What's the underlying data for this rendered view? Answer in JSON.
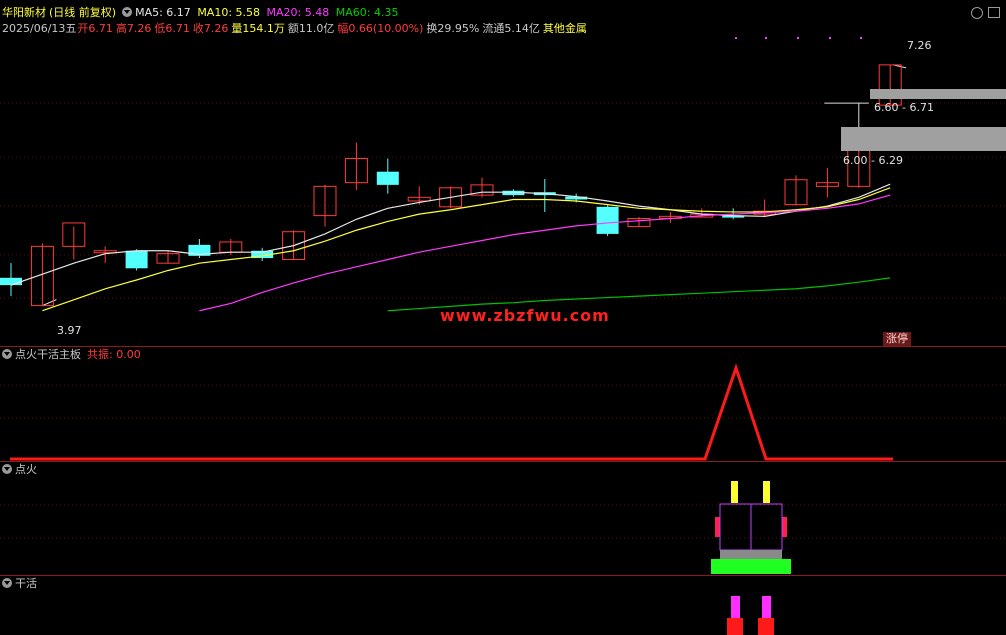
{
  "stock": {
    "name": "华阳新材",
    "period": "(日线 前复权)",
    "date": "2025/06/13五",
    "open": "开6.71",
    "high": "高7.26",
    "low": "低6.71",
    "close": "收7.26",
    "volume": "量154.1万",
    "amount": "额11.0亿",
    "change": "幅0.66(10.00%)",
    "turnover": "换29.95%",
    "float_cap": "流通5.14亿",
    "sector": "其他金属"
  },
  "ma": {
    "ma5": "MA5: 6.17",
    "ma10": "MA10: 5.58",
    "ma20": "MA20: 5.48",
    "ma60": "MA60: 4.35"
  },
  "price_labels": {
    "high_mark": "7.26",
    "low_mark": "3.97",
    "range1": "6.60 - 6.71",
    "range2": "6.00 - 6.29",
    "limit_up": "涨停"
  },
  "watermark": "www.zbzfwu.com",
  "indicators": {
    "ind1_title": "点火干活主板",
    "ind1_value": "共振: 0.00",
    "ind2_title": "点火",
    "ind3_title": "干活"
  },
  "colors": {
    "up": "#ff3b3b",
    "down": "#54ffff",
    "ma5": "#e6e6e6",
    "ma10": "#ffff3a",
    "ma20": "#ff3aff",
    "ma60": "#00c000",
    "separator": "#8b1a1a"
  },
  "chart_data": {
    "type": "candlestick",
    "y_range": [
      3.5,
      7.6
    ],
    "candles": [
      {
        "o": 4.35,
        "h": 4.55,
        "l": 4.1,
        "c": 4.25
      },
      {
        "o": 3.97,
        "h": 4.82,
        "l": 3.97,
        "c": 4.78
      },
      {
        "o": 4.78,
        "h": 5.05,
        "l": 4.6,
        "c": 5.1
      },
      {
        "o": 4.72,
        "h": 4.78,
        "l": 4.55,
        "c": 4.72
      },
      {
        "o": 4.72,
        "h": 4.74,
        "l": 4.45,
        "c": 4.48
      },
      {
        "o": 4.55,
        "h": 4.72,
        "l": 4.55,
        "c": 4.68
      },
      {
        "o": 4.8,
        "h": 4.88,
        "l": 4.62,
        "c": 4.65
      },
      {
        "o": 4.7,
        "h": 4.88,
        "l": 4.66,
        "c": 4.84
      },
      {
        "o": 4.72,
        "h": 4.76,
        "l": 4.58,
        "c": 4.62
      },
      {
        "o": 4.6,
        "h": 5.0,
        "l": 4.6,
        "c": 4.98
      },
      {
        "o": 5.2,
        "h": 5.62,
        "l": 5.05,
        "c": 5.6
      },
      {
        "o": 5.65,
        "h": 6.2,
        "l": 5.55,
        "c": 5.98
      },
      {
        "o": 5.8,
        "h": 5.98,
        "l": 5.5,
        "c": 5.62
      },
      {
        "o": 5.4,
        "h": 5.6,
        "l": 5.35,
        "c": 5.45
      },
      {
        "o": 5.32,
        "h": 5.6,
        "l": 5.3,
        "c": 5.58
      },
      {
        "o": 5.48,
        "h": 5.72,
        "l": 5.45,
        "c": 5.62
      },
      {
        "o": 5.54,
        "h": 5.56,
        "l": 5.46,
        "c": 5.48
      },
      {
        "o": 5.52,
        "h": 5.7,
        "l": 5.25,
        "c": 5.48
      },
      {
        "o": 5.46,
        "h": 5.5,
        "l": 5.38,
        "c": 5.42
      },
      {
        "o": 5.32,
        "h": 5.34,
        "l": 4.92,
        "c": 4.95
      },
      {
        "o": 5.05,
        "h": 5.18,
        "l": 5.05,
        "c": 5.16
      },
      {
        "o": 5.19,
        "h": 5.25,
        "l": 5.1,
        "c": 5.19
      },
      {
        "o": 5.18,
        "h": 5.3,
        "l": 5.18,
        "c": 5.22
      },
      {
        "o": 5.2,
        "h": 5.3,
        "l": 5.15,
        "c": 5.18
      },
      {
        "o": 5.22,
        "h": 5.42,
        "l": 5.18,
        "c": 5.26
      },
      {
        "o": 5.35,
        "h": 5.75,
        "l": 5.34,
        "c": 5.69
      },
      {
        "o": 5.6,
        "h": 5.85,
        "l": 5.45,
        "c": 5.65
      },
      {
        "o": 5.6,
        "h": 6.29,
        "l": 5.58,
        "c": 6.29
      },
      {
        "o": 6.71,
        "h": 7.26,
        "l": 6.71,
        "c": 7.26
      }
    ],
    "ma5": [
      4.25,
      4.4,
      4.55,
      4.68,
      4.72,
      4.72,
      4.67,
      4.7,
      4.7,
      4.79,
      4.95,
      5.15,
      5.3,
      5.38,
      5.45,
      5.52,
      5.52,
      5.5,
      5.46,
      5.4,
      5.33,
      5.28,
      5.22,
      5.2,
      5.19,
      5.26,
      5.33,
      5.45,
      5.63
    ],
    "ma10": [
      null,
      3.9,
      4.05,
      4.2,
      4.32,
      4.45,
      4.55,
      4.6,
      4.65,
      4.72,
      4.85,
      5.0,
      5.12,
      5.22,
      5.28,
      5.35,
      5.42,
      5.42,
      5.4,
      5.35,
      5.3,
      5.28,
      5.26,
      5.25,
      5.25,
      5.28,
      5.32,
      5.42,
      5.58
    ],
    "ma20": [
      null,
      null,
      null,
      null,
      null,
      null,
      3.9,
      4.0,
      4.15,
      4.28,
      4.4,
      4.5,
      4.6,
      4.7,
      4.78,
      4.86,
      4.94,
      5.0,
      5.06,
      5.1,
      5.13,
      5.16,
      5.2,
      5.22,
      5.24,
      5.26,
      5.3,
      5.36,
      5.48
    ],
    "ma60": [
      null,
      null,
      null,
      null,
      null,
      null,
      null,
      null,
      null,
      null,
      null,
      null,
      3.9,
      3.93,
      3.96,
      3.99,
      4.01,
      4.04,
      4.06,
      4.08,
      4.1,
      4.12,
      4.14,
      4.16,
      4.18,
      4.2,
      4.24,
      4.29,
      4.35
    ]
  }
}
